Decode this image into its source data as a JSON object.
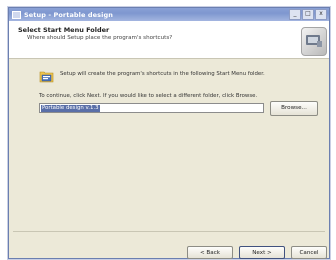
{
  "window": {
    "title": "Setup - Portable design",
    "title_buttons": {
      "minimize": "_",
      "maximize": "□",
      "close": "x"
    }
  },
  "header": {
    "title": "Select Start Menu Folder",
    "subtitle": "Where should Setup place the program's shortcuts?",
    "logo_icon": "installer-logo-icon"
  },
  "body": {
    "icon": "start-menu-folder-icon",
    "description": "Setup will create the program's shortcuts in the following Start Menu folder.",
    "instruction": "To continue, click Next. If you would like to select a different folder, click Browse.",
    "folder_input_value": "Portable design v.1.3",
    "browse_label": "Browse..."
  },
  "footer": {
    "back_label": "< Back",
    "next_label": "Next >",
    "cancel_label": "Cancel"
  },
  "colors": {
    "titlebar": "#7e97cf",
    "dialog_bg": "#ece9d8",
    "selection": "#5a6fa8"
  }
}
